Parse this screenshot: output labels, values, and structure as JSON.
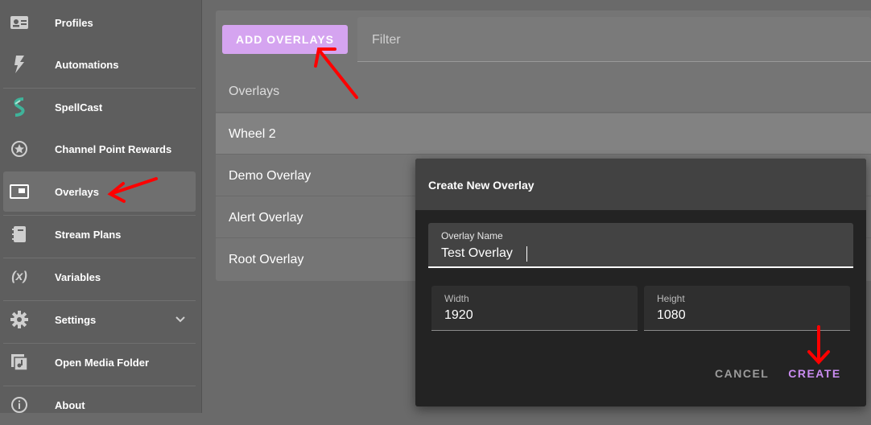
{
  "sidebar": {
    "items": [
      {
        "label": "Profiles",
        "icon": "profile-card-icon"
      },
      {
        "label": "Automations",
        "icon": "lightning-icon"
      },
      {
        "label": "SpellCast",
        "icon": "spellcast-logo-icon"
      },
      {
        "label": "Channel Point Rewards",
        "icon": "star-circle-icon"
      },
      {
        "label": "Overlays",
        "icon": "overlay-window-icon",
        "active": true
      },
      {
        "label": "Stream Plans",
        "icon": "notebook-icon"
      },
      {
        "label": "Variables",
        "icon": "variable-x-icon",
        "glyph": "(x)"
      },
      {
        "label": "Settings",
        "icon": "gear-icon"
      },
      {
        "label": "Open Media Folder",
        "icon": "media-folder-icon"
      },
      {
        "label": "About",
        "icon": "info-icon"
      }
    ]
  },
  "toolbar": {
    "add_label": "ADD OVERLAYS",
    "filter_placeholder": "Filter"
  },
  "list": {
    "header": "Overlays",
    "rows": [
      "Wheel 2",
      "Demo Overlay",
      "Alert Overlay",
      "Root Overlay"
    ]
  },
  "dialog": {
    "title": "Create New Overlay",
    "name_label": "Overlay Name",
    "name_value": "Test Overlay",
    "width_label": "Width",
    "width_value": "1920",
    "height_label": "Height",
    "height_value": "1080",
    "cancel_label": "CANCEL",
    "create_label": "CREATE"
  },
  "colors": {
    "accent": "#c98cf0",
    "add_button": "#d5a4f0",
    "annotation_arrow": "#ff0000"
  }
}
